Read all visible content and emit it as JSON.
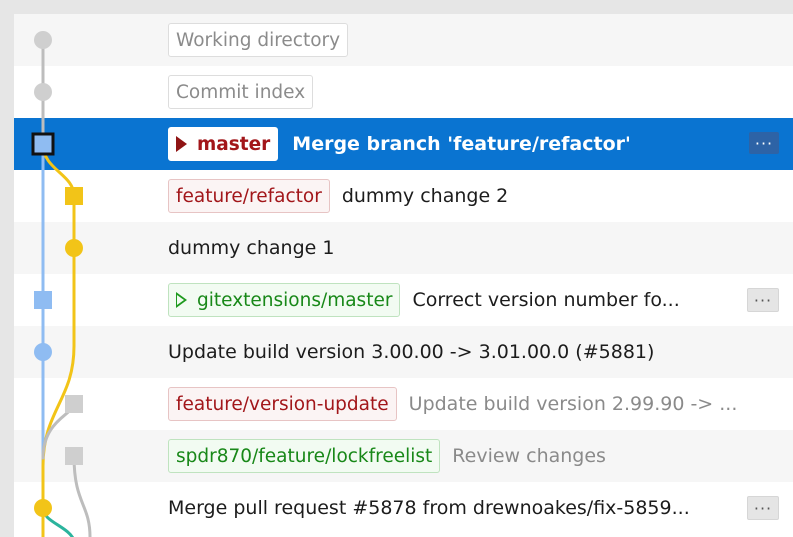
{
  "colors": {
    "selection": "#0a74d1",
    "lane_gray": "#bdbdbd",
    "lane_blue": "#8fbcf2",
    "lane_yellow": "#f2c418",
    "lane_teal": "#2bb49d"
  },
  "rows": [
    {
      "ref": {
        "label": "Working directory",
        "style": "gray"
      },
      "message": "",
      "node": {
        "shape": "circle",
        "color": "#cfcfcf"
      }
    },
    {
      "ref": {
        "label": "Commit index",
        "style": "gray"
      },
      "message": "",
      "node": {
        "shape": "circle",
        "color": "#cfcfcf"
      }
    },
    {
      "ref": {
        "label": "master",
        "style": "master",
        "icon": "solid-triangle-icon"
      },
      "message": "Merge branch 'feature/refactor'",
      "selected": true,
      "more": "···",
      "node": {
        "shape": "square-outline",
        "color": "#8fbcf2"
      }
    },
    {
      "ref": {
        "label": "feature/refactor",
        "style": "red"
      },
      "message": "dummy change 2",
      "node": {
        "shape": "square",
        "color": "#f2c418"
      }
    },
    {
      "ref": null,
      "message": "dummy change 1",
      "node": {
        "shape": "circle",
        "color": "#f2c418"
      }
    },
    {
      "ref": {
        "label": "gitextensions/master",
        "style": "green",
        "icon": "outline-triangle-icon"
      },
      "message": "Correct version number fo...",
      "more": "···",
      "node": {
        "shape": "square",
        "color": "#8fbcf2"
      }
    },
    {
      "ref": null,
      "message": "Update build version 3.00.00 -> 3.01.00.0 (#5881)",
      "node": {
        "shape": "circle",
        "color": "#8fbcf2"
      }
    },
    {
      "ref": {
        "label": "feature/version-update",
        "style": "red"
      },
      "message": "Update build version 2.99.90 -> ...",
      "dim": true,
      "node": {
        "shape": "square",
        "color": "#cfcfcf"
      }
    },
    {
      "ref": {
        "label": "spdr870/feature/lockfreelist",
        "style": "green"
      },
      "message": "Review changes",
      "dim": true,
      "node": {
        "shape": "square",
        "color": "#cfcfcf"
      }
    },
    {
      "ref": null,
      "message": "Merge pull request #5878 from drewnoakes/fix-5859...",
      "more": "···",
      "node": {
        "shape": "circle",
        "color": "#f2c418"
      }
    }
  ]
}
